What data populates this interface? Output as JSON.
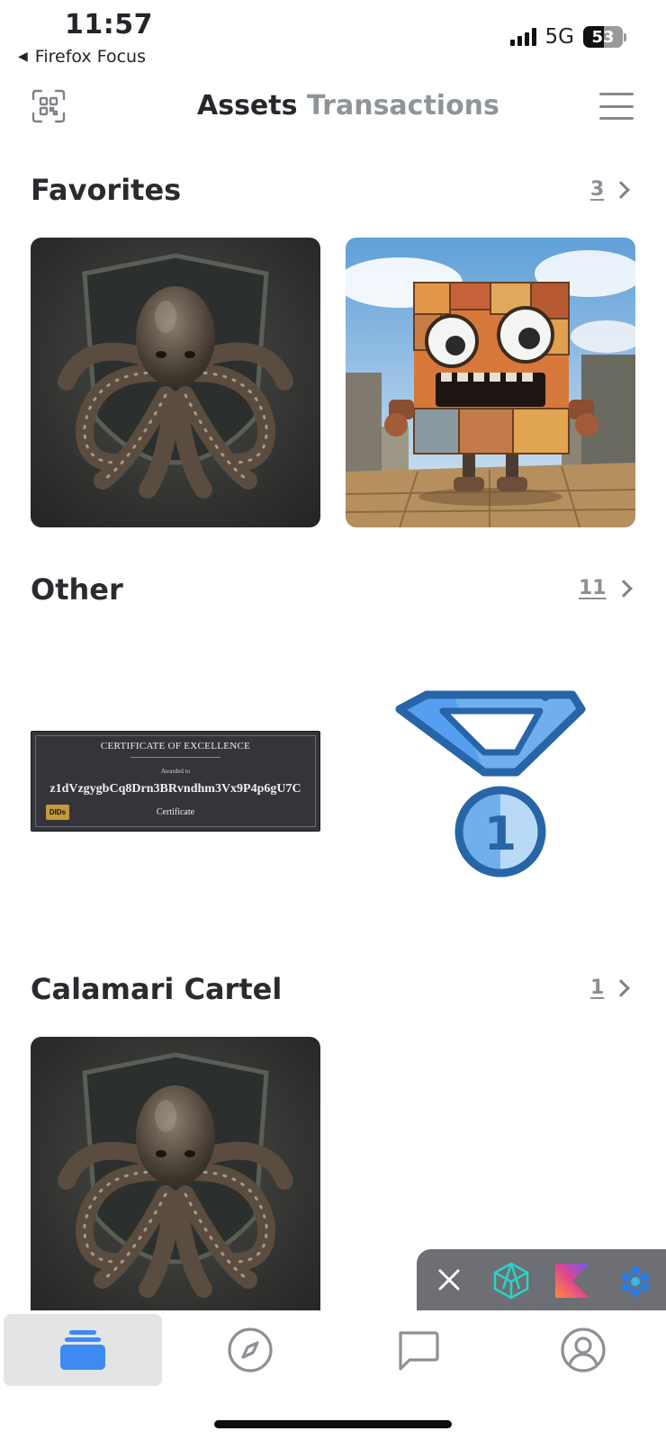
{
  "status_bar": {
    "time": "11:57",
    "back_app": "Firefox Focus",
    "network": "5G",
    "battery": "53"
  },
  "header": {
    "tabs": [
      {
        "label": "Assets",
        "active": true
      },
      {
        "label": "Transactions",
        "active": false
      }
    ]
  },
  "sections": {
    "favorites": {
      "title": "Favorites",
      "count": "3"
    },
    "other": {
      "title": "Other",
      "count": "11"
    },
    "calamari": {
      "title": "Calamari Cartel",
      "count": "1"
    }
  },
  "certificate": {
    "title": "CERTIFICATE OF EXCELLENCE",
    "awarded": "Awarded to",
    "id": "z1dVzgygbCq8Drn3BRvndhm3Vx9P4p6gU7C",
    "subtitle": "Certificate",
    "badge": "DIDs"
  },
  "medal": {
    "number": "1"
  },
  "icons": {
    "qr": "qr-scan-icon",
    "menu": "hamburger-menu-icon",
    "close": "close-icon",
    "nav": [
      "wallet-icon",
      "compass-icon",
      "chat-icon",
      "profile-icon"
    ]
  },
  "colors": {
    "accent": "#3d8bf2",
    "medal_dark": "#2864a8",
    "medal_light": "#6fb0ec"
  }
}
